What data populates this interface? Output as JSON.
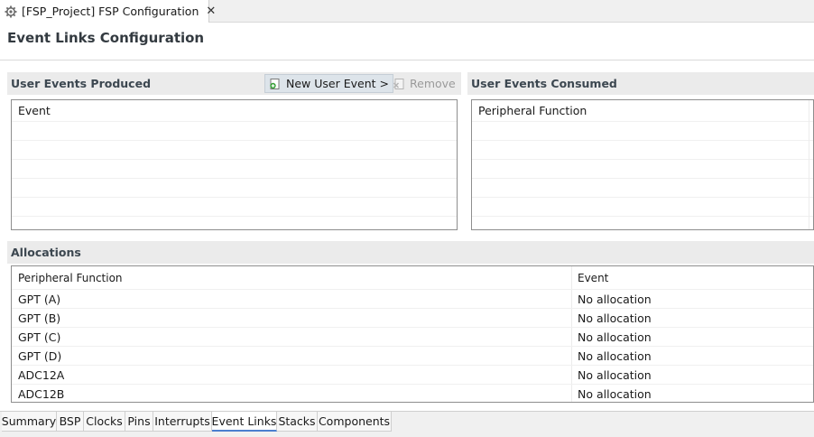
{
  "editor_tab": {
    "title": "[FSP_Project] FSP Configuration",
    "icon": "gear-icon",
    "close": "✕"
  },
  "page_title": "Event Links Configuration",
  "produced": {
    "header": "User Events Produced",
    "new_button": "New User Event >",
    "remove_button": "Remove",
    "column": "Event"
  },
  "consumed": {
    "header": "User Events Consumed",
    "column": "Peripheral Function"
  },
  "allocations": {
    "header": "Allocations",
    "columns": [
      "Peripheral Function",
      "Event"
    ],
    "rows": [
      [
        "GPT (A)",
        "No allocation"
      ],
      [
        "GPT (B)",
        "No allocation"
      ],
      [
        "GPT (C)",
        "No allocation"
      ],
      [
        "GPT (D)",
        "No allocation"
      ],
      [
        "ADC12A",
        "No allocation"
      ],
      [
        "ADC12B",
        "No allocation"
      ]
    ]
  },
  "bottom_tabs": [
    "Summary",
    "BSP",
    "Clocks",
    "Pins",
    "Interrupts",
    "Event Links",
    "Stacks",
    "Components"
  ],
  "active_tab": "Event Links",
  "colors": {
    "accent": "#4a7fcf",
    "header_bg": "#ebebeb",
    "disabled_text": "#9a9a9a"
  }
}
